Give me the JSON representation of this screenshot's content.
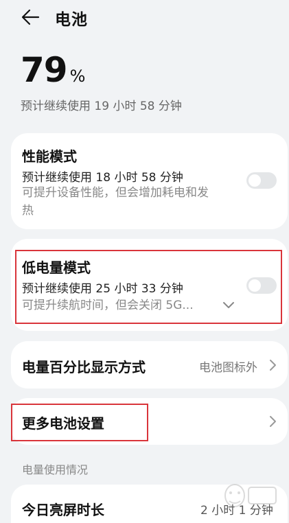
{
  "header": {
    "title": "电池",
    "back_icon": "arrow-left-icon"
  },
  "battery": {
    "percent": "79",
    "unit": "%",
    "estimate": "预计继续使用 19 小时 58 分钟"
  },
  "performance_mode": {
    "title": "性能模式",
    "estimate": "预计继续使用 18 小时 58 分钟",
    "desc_line1": "可提升设备性能，但会增加耗电和发",
    "desc_line2": "热",
    "enabled": false
  },
  "low_power_mode": {
    "title": "低电量模式",
    "estimate": "预计继续使用 25 小时 33 分钟",
    "desc": "可提升续航时间，但会关闭 5G...",
    "enabled": false,
    "expand_icon": "chevron-down-icon"
  },
  "percentage_display": {
    "title": "电量百分比显示方式",
    "value": "电池图标外"
  },
  "more_settings": {
    "title": "更多电池设置"
  },
  "usage_section": {
    "label": "电量使用情况"
  },
  "screen_time": {
    "title": "今日亮屏时长",
    "value": "2 小时 1 分钟"
  },
  "colors": {
    "background": "#f1f3f5",
    "card": "#ffffff",
    "highlight": "#d9343a",
    "toggle_off": "#e4e6e8"
  }
}
